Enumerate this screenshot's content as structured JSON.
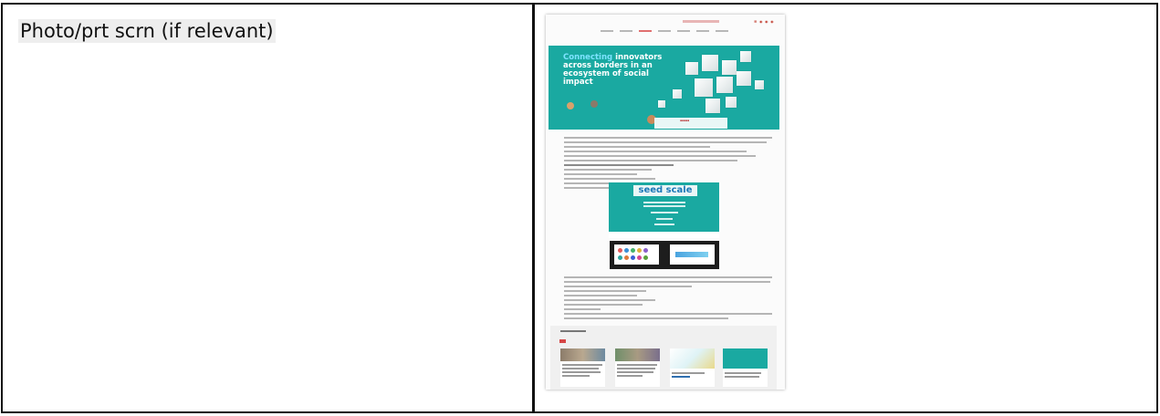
{
  "cell": {
    "label": "Photo/prt scrn (if relevant)"
  },
  "screenshot": {
    "hero_headline_accent": "Connecting",
    "hero_headline_rest": " innovators across borders in an ecosystem of social impact",
    "seed_logo": "seed scale",
    "colors": {
      "teal": "#1aa9a1",
      "red": "#d64545",
      "cyan_text": "#7de3ff"
    }
  }
}
